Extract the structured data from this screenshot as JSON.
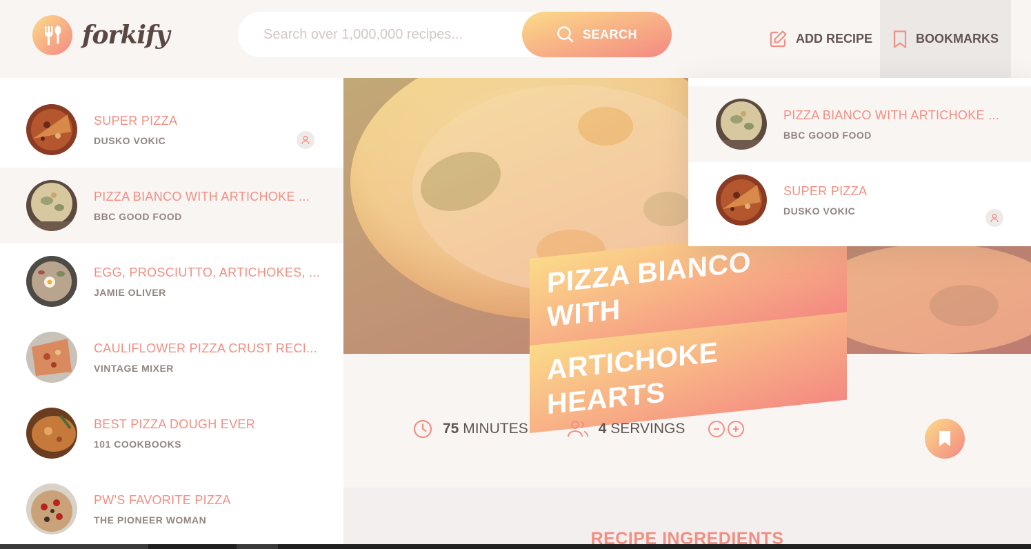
{
  "header": {
    "logo_text": "forkify",
    "search": {
      "placeholder": "Search over 1,000,000 recipes...",
      "button_label": "SEARCH"
    },
    "nav": {
      "add_recipe_label": "ADD RECIPE",
      "bookmarks_label": "BOOKMARKS"
    }
  },
  "results": {
    "items": [
      {
        "title": "SUPER PIZZA",
        "publisher": "DUSKO VOKIC",
        "user_generated": true,
        "active": false
      },
      {
        "title": "PIZZA BIANCO WITH ARTICHOKE ...",
        "publisher": "BBC GOOD FOOD",
        "user_generated": false,
        "active": true
      },
      {
        "title": "EGG, PROSCIUTTO, ARTICHOKES, ...",
        "publisher": "JAMIE OLIVER",
        "user_generated": false,
        "active": false
      },
      {
        "title": "CAULIFLOWER PIZZA CRUST RECI...",
        "publisher": "VINTAGE MIXER",
        "user_generated": false,
        "active": false
      },
      {
        "title": "BEST PIZZA DOUGH EVER",
        "publisher": "101 COOKBOOKS",
        "user_generated": false,
        "active": false
      },
      {
        "title": "PW'S FAVORITE PIZZA",
        "publisher": "THE PIONEER WOMAN",
        "user_generated": false,
        "active": false
      }
    ]
  },
  "bookmarks": {
    "items": [
      {
        "title": "PIZZA BIANCO WITH ARTICHOKE ...",
        "publisher": "BBC GOOD FOOD",
        "user_generated": false
      },
      {
        "title": "SUPER PIZZA",
        "publisher": "DUSKO VOKIC",
        "user_generated": true
      }
    ]
  },
  "recipe": {
    "title_line1": "PIZZA BIANCO WITH",
    "title_line2": "ARTICHOKE HEARTS",
    "cooking_time": "75",
    "cooking_time_unit": "MINUTES",
    "servings": "4",
    "servings_unit": "SERVINGS",
    "ingredients_title": "RECIPE INGREDIENTS"
  },
  "colors": {
    "accent": "#f38e82",
    "gradient_start": "#fbdb89",
    "gradient_end": "#f48982",
    "text": "#615551",
    "background": "#f9f5f3"
  }
}
